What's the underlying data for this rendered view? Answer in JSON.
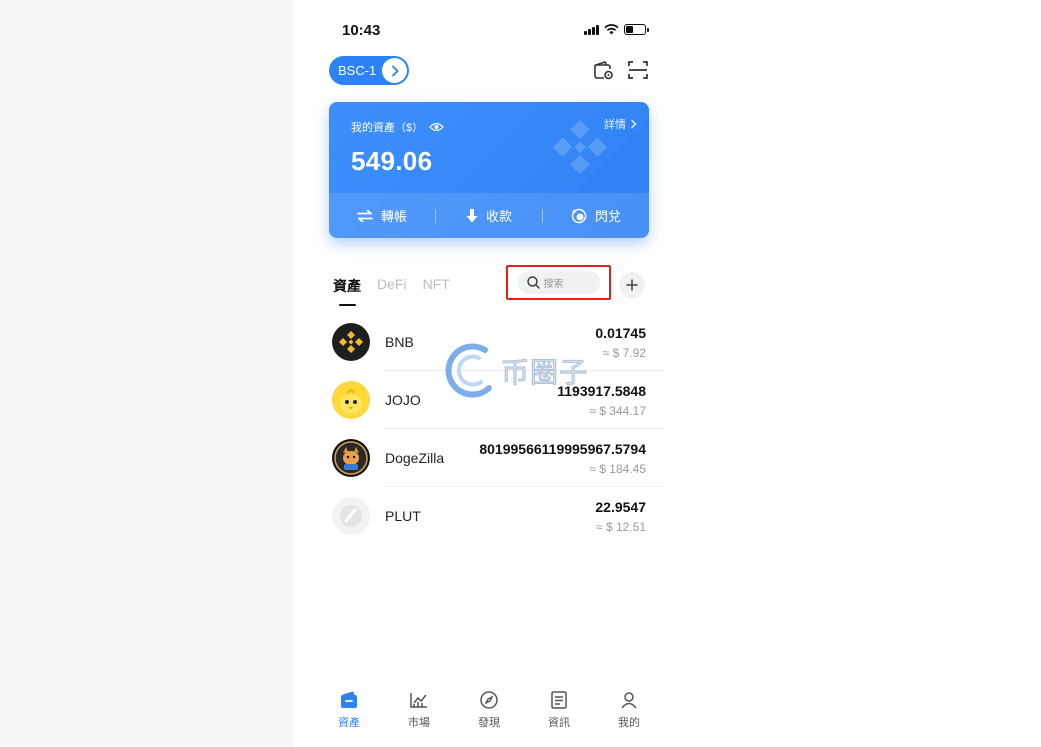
{
  "status_bar": {
    "time": "10:43"
  },
  "network": {
    "label": "BSC-1"
  },
  "asset_card": {
    "label": "我的資產（$）",
    "amount": "549.06",
    "detail_label": "詳情",
    "actions": [
      {
        "label": "轉帳",
        "icon": "transfer-icon"
      },
      {
        "label": "收款",
        "icon": "receive-icon"
      },
      {
        "label": "閃兌",
        "icon": "swap-icon"
      }
    ]
  },
  "tabs": [
    {
      "label": "資產",
      "active": true
    },
    {
      "label": "DeFi",
      "active": false
    },
    {
      "label": "NFT",
      "active": false
    }
  ],
  "search": {
    "placeholder": "搜索"
  },
  "tokens": [
    {
      "name": "BNB",
      "amount": "0.01745",
      "value": "≈ $ 7.92"
    },
    {
      "name": "JOJO",
      "amount": "1193917.5848",
      "value": "≈ $ 344.17"
    },
    {
      "name": "DogeZilla",
      "amount": "80199566119995967.5794",
      "value": "≈ $ 184.45"
    },
    {
      "name": "PLUT",
      "amount": "22.9547",
      "value": "≈ $ 12.51"
    }
  ],
  "watermark": {
    "text": "币圈子"
  },
  "bottom_nav": [
    {
      "label": "資產",
      "icon": "wallet-icon",
      "active": true
    },
    {
      "label": "市場",
      "icon": "chart-icon",
      "active": false
    },
    {
      "label": "發現",
      "icon": "compass-icon",
      "active": false
    },
    {
      "label": "資訊",
      "icon": "news-icon",
      "active": false
    },
    {
      "label": "我的",
      "icon": "profile-icon",
      "active": false
    }
  ],
  "colors": {
    "accent": "#2d82f6",
    "highlight_border": "#e0231c"
  }
}
